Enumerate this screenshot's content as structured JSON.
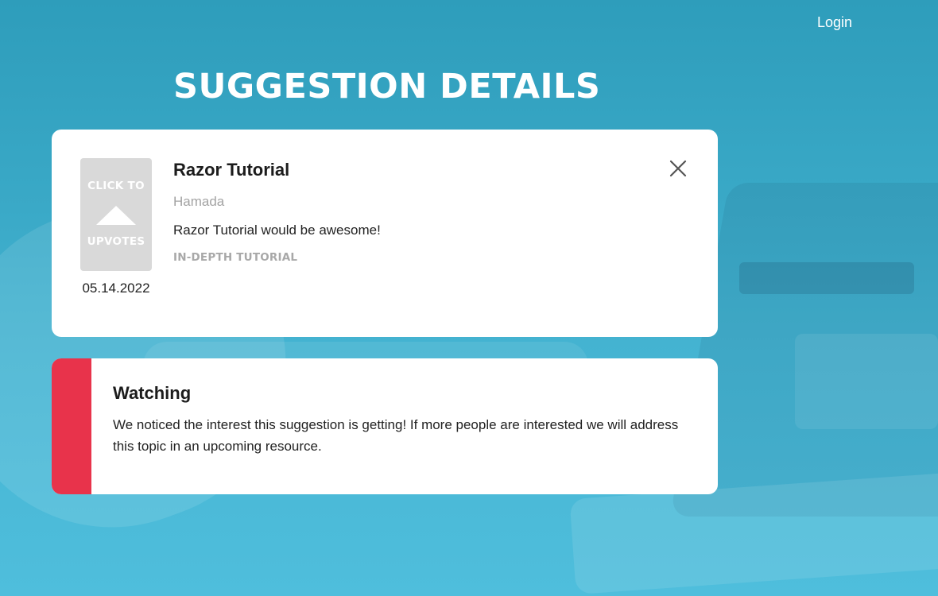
{
  "header": {
    "login_label": "Login"
  },
  "page": {
    "title": "SUGGESTION DETAILS"
  },
  "suggestion": {
    "upvote_top_text": "CLICK TO",
    "upvote_bottom_text": "UPVOTES",
    "upvote_icon": "triangle-up-icon",
    "date": "05.14.2022",
    "title": "Razor Tutorial",
    "author": "Hamada",
    "description": "Razor Tutorial would be awesome!",
    "category": "IN-DEPTH TUTORIAL",
    "close_icon": "close-icon"
  },
  "status": {
    "title": "Watching",
    "description": "We noticed the interest this suggestion is getting! If more people are interested we will address this topic in an upcoming resource.",
    "color": "#e8334b"
  },
  "colors": {
    "background": "#3aa9c7",
    "card": "#ffffff",
    "upvote_box": "#d9d9d9",
    "muted_text": "#a3a3a3",
    "status_accent": "#e8334b"
  }
}
